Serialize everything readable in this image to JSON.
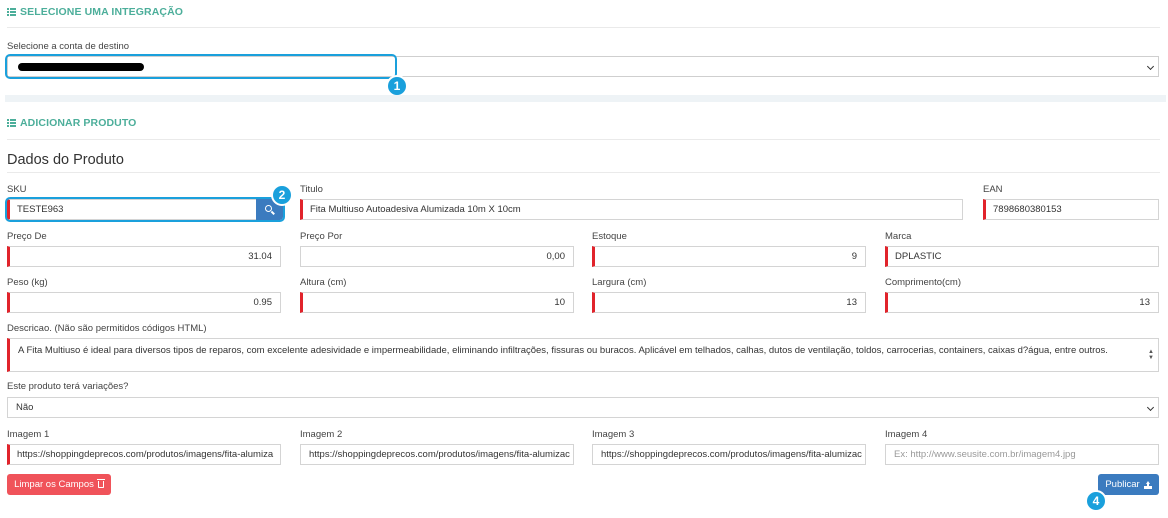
{
  "integration": {
    "header": "SELECIONE UMA INTEGRAÇÃO",
    "account_label": "Selecione a conta de destino",
    "account_value": ""
  },
  "product": {
    "header": "ADICIONAR PRODUTO",
    "subtitle": "Dados do Produto",
    "sku": {
      "label": "SKU",
      "value": "TESTE963"
    },
    "titulo": {
      "label": "Titulo",
      "value": "Fita Multiuso Autoadesiva Alumizada 10m X 10cm"
    },
    "ean": {
      "label": "EAN",
      "value": "7898680380153"
    },
    "preco_de": {
      "label": "Preço De",
      "value": "31.04"
    },
    "preco_por": {
      "label": "Preço Por",
      "value": "0,00"
    },
    "estoque": {
      "label": "Estoque",
      "value": "9"
    },
    "marca": {
      "label": "Marca",
      "value": "DPLASTIC"
    },
    "peso": {
      "label": "Peso (kg)",
      "value": "0.95"
    },
    "altura": {
      "label": "Altura (cm)",
      "value": "10"
    },
    "largura": {
      "label": "Largura (cm)",
      "value": "13"
    },
    "comprimento": {
      "label": "Comprimento(cm)",
      "value": "13"
    },
    "descricao": {
      "label": "Descricao. (Não são permitidos códigos HTML)",
      "value": "A Fita Multiuso  é ideal para diversos tipos de reparos, com excelente adesividade e impermeabilidade, eliminando infiltrações, fissuras ou buracos. Aplicável em telhados, calhas, dutos de ventilação, toldos, carrocerias, containers, caixas d?água, entre outros."
    },
    "variacoes": {
      "label": "Este produto terá variações?",
      "value": "Não"
    },
    "imagem1": {
      "label": "Imagem 1",
      "value": "https://shoppingdeprecos.com/produtos/imagens/fita-alumiza"
    },
    "imagem2": {
      "label": "Imagem 2",
      "value": "https://shoppingdeprecos.com/produtos/imagens/fita-alumizac"
    },
    "imagem3": {
      "label": "Imagem 3",
      "value": "https://shoppingdeprecos.com/produtos/imagens/fita-alumizac"
    },
    "imagem4": {
      "label": "Imagem 4",
      "value": "",
      "placeholder": "Ex: http://www.seusite.com.br/imagem4.jpg"
    }
  },
  "buttons": {
    "clear": "Limpar os Campos",
    "publish": "Publicar"
  },
  "badges": [
    "1",
    "2",
    "4"
  ],
  "colors": {
    "accent": "#4cae9a",
    "primary": "#3b7bbf",
    "danger": "#f0535a",
    "required": "#e1232b",
    "highlight": "#1aa0dc"
  },
  "icons": [
    "list-icon",
    "search-icon",
    "trash-icon",
    "upload-icon",
    "chevron-down-icon"
  ]
}
